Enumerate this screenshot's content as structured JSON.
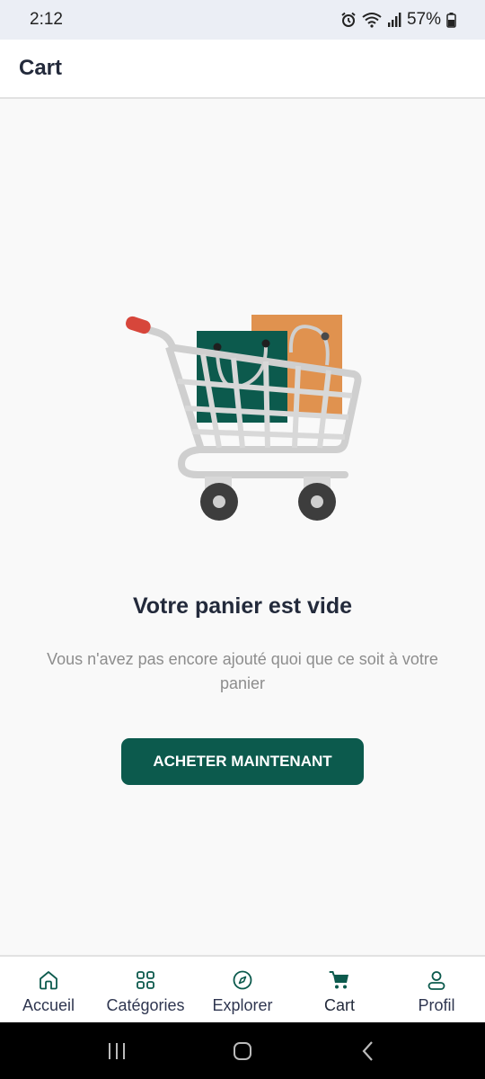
{
  "status_bar": {
    "time": "2:12",
    "battery": "57%"
  },
  "app_bar": {
    "title": "Cart"
  },
  "empty_state": {
    "title": "Votre panier est vide",
    "description": "Vous n'avez pas encore ajouté quoi que ce soit à votre panier",
    "button_label": "ACHETER MAINTENANT",
    "illustration": "shopping-cart-with-bags",
    "colors": {
      "bag_green": "#0c5a4d",
      "bag_orange": "#e0924f",
      "cart_grey": "#cfcfcf",
      "handle_red": "#d7463b"
    }
  },
  "bottom_nav": {
    "items": [
      {
        "label": "Accueil",
        "icon": "home-icon"
      },
      {
        "label": "Catégories",
        "icon": "grid-icon"
      },
      {
        "label": "Explorer",
        "icon": "compass-icon"
      },
      {
        "label": "Cart",
        "icon": "cart-icon",
        "active": true
      },
      {
        "label": "Profil",
        "icon": "user-icon"
      }
    ]
  },
  "theme": {
    "primary": "#0c5a4d",
    "text_dark": "#232a3b",
    "text_muted": "#8d8d8d"
  }
}
